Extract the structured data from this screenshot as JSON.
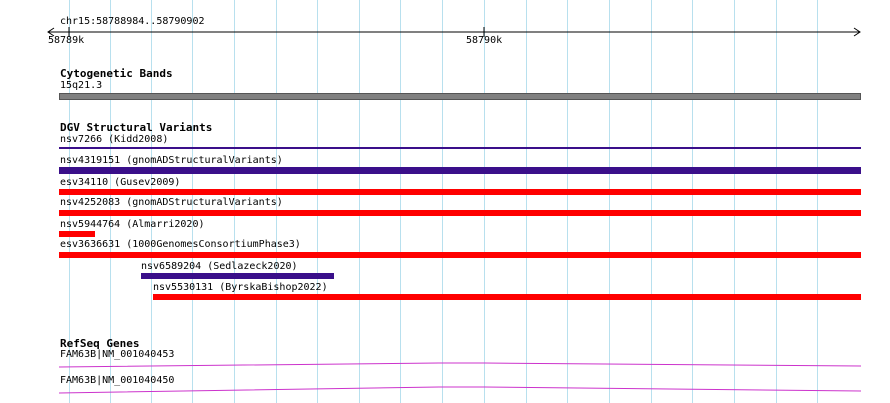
{
  "colors": {
    "grid_line": "#b8e0ee",
    "cytoband": "#808080",
    "gain": "#3a0f8a",
    "loss": "#ff0000",
    "refseq": "#cc33cc"
  },
  "ruler": {
    "location": "chr15:58788984..58790902",
    "tick_start": "58789k",
    "tick_mid": "58790k"
  },
  "cytogenetic_bands": {
    "title": "Cytogenetic Bands",
    "band_label": "15q21.3"
  },
  "dgv": {
    "title": "DGV Structural Variants",
    "variants": [
      {
        "label": "nsv7266 (Kidd2008)",
        "type": "gain"
      },
      {
        "label": "nsv4319151 (gnomADStructuralVariants)",
        "type": "gain"
      },
      {
        "label": "esv34110 (Gusev2009)",
        "type": "loss"
      },
      {
        "label": "nsv4252083 (gnomADStructuralVariants)",
        "type": "loss"
      },
      {
        "label": "nsv5944764 (Almarri2020)",
        "type": "loss"
      },
      {
        "label": "esv3636631 (1000GenomesConsortiumPhase3)",
        "type": "loss"
      },
      {
        "label": "nsv6589204 (Sedlazeck2020)",
        "type": "gain"
      },
      {
        "label": "nsv5530131 (ByrskaBishop2022)",
        "type": "loss"
      }
    ]
  },
  "refseq": {
    "title": "RefSeq Genes",
    "genes": [
      {
        "label": "FAM63B|NM_001040453"
      },
      {
        "label": "FAM63B|NM_001040450"
      }
    ]
  }
}
